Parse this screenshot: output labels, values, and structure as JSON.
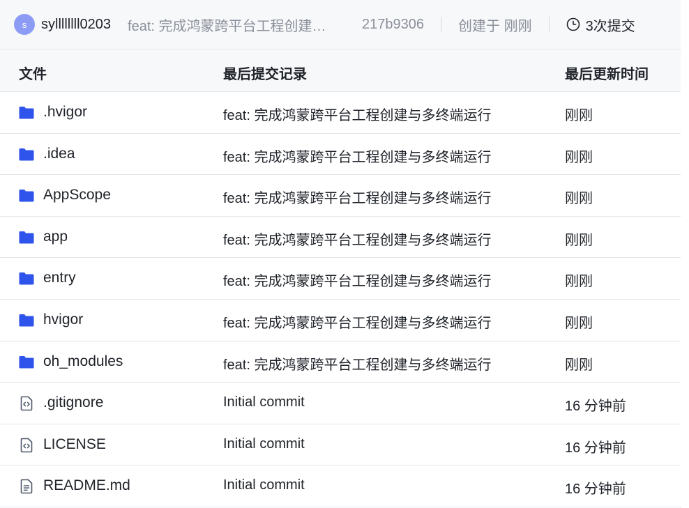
{
  "commit": {
    "avatar_letter": "s",
    "author": "syllllllll0203",
    "message": "feat: 完成鸿蒙跨平台工程创建与多终端运行",
    "hash": "217b9306",
    "created": "创建于 刚刚",
    "commit_count": "3次提交"
  },
  "table": {
    "headers": {
      "name": "文件",
      "commit": "最后提交记录",
      "time": "最后更新时间"
    },
    "rows": [
      {
        "type": "folder",
        "name": ".hvigor",
        "commit": "feat: 完成鸿蒙跨平台工程创建与多终端运行",
        "time": "刚刚"
      },
      {
        "type": "folder",
        "name": ".idea",
        "commit": "feat: 完成鸿蒙跨平台工程创建与多终端运行",
        "time": "刚刚"
      },
      {
        "type": "folder",
        "name": "AppScope",
        "commit": "feat: 完成鸿蒙跨平台工程创建与多终端运行",
        "time": "刚刚"
      },
      {
        "type": "folder",
        "name": "app",
        "commit": "feat: 完成鸿蒙跨平台工程创建与多终端运行",
        "time": "刚刚"
      },
      {
        "type": "folder",
        "name": "entry",
        "commit": "feat: 完成鸿蒙跨平台工程创建与多终端运行",
        "time": "刚刚"
      },
      {
        "type": "folder",
        "name": "hvigor",
        "commit": "feat: 完成鸿蒙跨平台工程创建与多终端运行",
        "time": "刚刚"
      },
      {
        "type": "folder",
        "name": "oh_modules",
        "commit": "feat: 完成鸿蒙跨平台工程创建与多终端运行",
        "time": "刚刚"
      },
      {
        "type": "code-file",
        "name": ".gitignore",
        "commit": "Initial commit",
        "time": "16 分钟前"
      },
      {
        "type": "code-file",
        "name": "LICENSE",
        "commit": "Initial commit",
        "time": "16 分钟前"
      },
      {
        "type": "text-file",
        "name": "README.md",
        "commit": "Initial commit",
        "time": "16 分钟前"
      }
    ]
  },
  "colors": {
    "folder": "#2f54eb",
    "file_icon": "#4e5969",
    "avatar": "#8c9cf4",
    "muted_text": "#8a8f99"
  }
}
